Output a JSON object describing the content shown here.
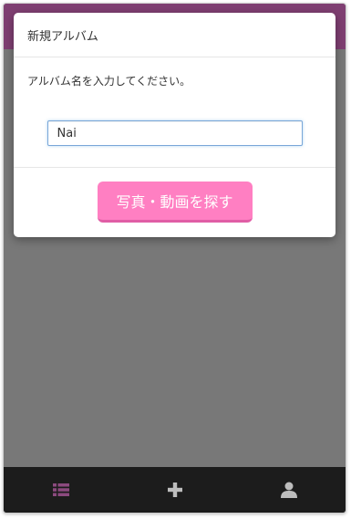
{
  "modal": {
    "title": "新規アルバム",
    "prompt": "アルバム名を入力してください。",
    "input_value": "Nai",
    "search_button_label": "写真・動画を探す"
  },
  "nav": {
    "items": [
      {
        "icon": "list-icon",
        "active": true
      },
      {
        "icon": "plus-icon",
        "active": false
      },
      {
        "icon": "user-icon",
        "active": false
      }
    ]
  },
  "colors": {
    "header_bar": "#7f3f72",
    "button_pink": "#ff7fc2",
    "nav_active": "#8b4a7e",
    "nav_inactive": "#bdbdbd",
    "nav_background": "#1c1c1c",
    "backdrop": "#787878"
  }
}
